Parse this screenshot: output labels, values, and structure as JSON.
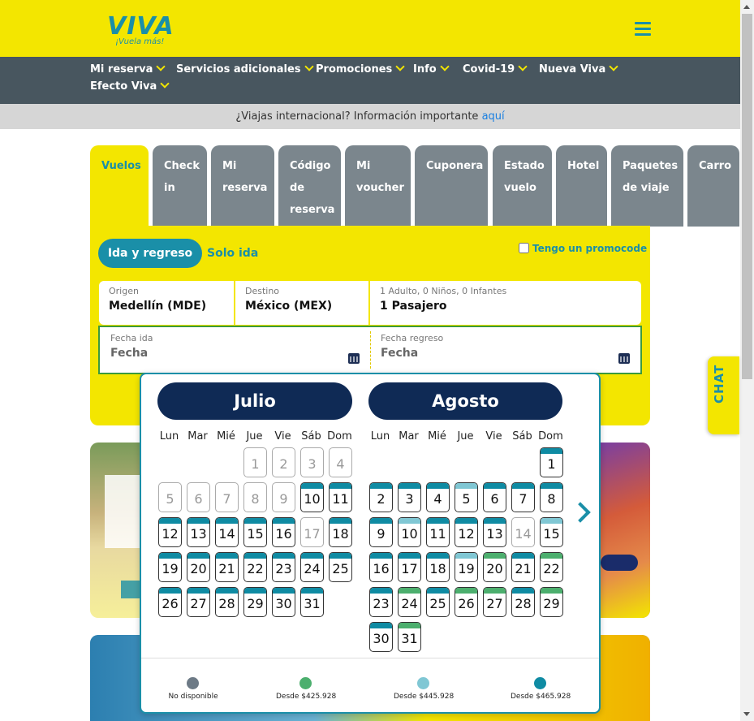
{
  "header": {
    "logo_text": "VIVA",
    "logo_tagline": "¡Vuela más!"
  },
  "nav": {
    "items": [
      {
        "label": "Mi reserva"
      },
      {
        "label": "Servicios adicionales"
      },
      {
        "label": "Promociones"
      },
      {
        "label": "Info"
      },
      {
        "label": "Covid-19"
      },
      {
        "label": "Nueva Viva"
      },
      {
        "label": "Efecto Viva"
      }
    ]
  },
  "notice": {
    "text": "¿Viajas internacional? Información importante ",
    "link": "aquí"
  },
  "tabs": [
    {
      "label": "Vuelos"
    },
    {
      "label": "Check in"
    },
    {
      "label": "Mi reserva"
    },
    {
      "label": "Código de reserva"
    },
    {
      "label": "Mi voucher"
    },
    {
      "label": "Cuponera"
    },
    {
      "label": "Estado vuelo"
    },
    {
      "label": "Hotel"
    },
    {
      "label": "Paquetes de viaje"
    },
    {
      "label": "Carro"
    }
  ],
  "search": {
    "round_trip": "Ida y regreso",
    "one_way": "Solo ida",
    "promo_label": "Tengo un promocode",
    "origin_label": "Origen",
    "origin_value": "Medellín (MDE)",
    "dest_label": "Destino",
    "dest_value": "México (MEX)",
    "pax_label": "1 Adulto, 0 Niños, 0 Infantes",
    "pax_value": "1 Pasajero",
    "depart_label": "Fecha ida",
    "depart_placeholder": "Fecha",
    "return_label": "Fecha regreso",
    "return_placeholder": "Fecha"
  },
  "calendar": {
    "weekdays": [
      "Lun",
      "Mar",
      "Mié",
      "Jue",
      "Vie",
      "Sáb",
      "Dom"
    ],
    "colors": {
      "na": "#6d7a86",
      "green": "#4caf6e",
      "light": "#80c7d4",
      "dark": "#0f8ba3"
    },
    "months": [
      {
        "name": "Julio",
        "offset": 3,
        "days": [
          "na",
          "na",
          "na",
          "na",
          "na",
          "na",
          "na",
          "na",
          "na",
          "dark",
          "dark",
          "dark",
          "dark",
          "dark",
          "dark",
          "dark",
          "na",
          "dark",
          "dark",
          "dark",
          "dark",
          "dark",
          "dark",
          "dark",
          "dark",
          "dark",
          "dark",
          "dark",
          "dark",
          "dark",
          "dark"
        ]
      },
      {
        "name": "Agosto",
        "offset": 6,
        "days": [
          "dark",
          "dark",
          "dark",
          "dark",
          "light",
          "dark",
          "dark",
          "dark",
          "dark",
          "light",
          "dark",
          "dark",
          "dark",
          "na",
          "light",
          "dark",
          "dark",
          "dark",
          "light",
          "green",
          "dark",
          "green",
          "dark",
          "green",
          "dark",
          "green",
          "green",
          "dark",
          "green",
          "dark",
          "green"
        ]
      }
    ],
    "legend": [
      {
        "key": "na",
        "label": "No disponible"
      },
      {
        "key": "green",
        "label": "Desde $425.928"
      },
      {
        "key": "light",
        "label": "Desde $445.928"
      },
      {
        "key": "dark",
        "label": "Desde $465.928"
      }
    ]
  },
  "chat": {
    "label": "CHAT"
  },
  "colors": {
    "brand_yellow": "#f3e600",
    "brand_teal": "#1a8fa8",
    "nav_gray": "#48565f",
    "navy": "#0f2a55"
  }
}
